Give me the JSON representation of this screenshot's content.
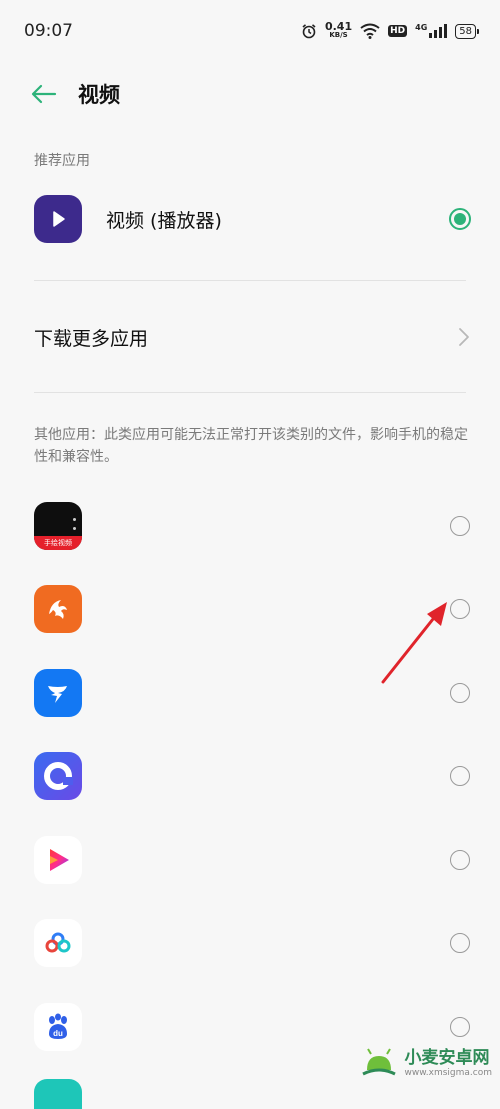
{
  "status_bar": {
    "time": "09:07",
    "speed_value": "0.41",
    "speed_unit": "KB/S",
    "hd": "HD",
    "network": "4G",
    "battery": "58"
  },
  "header": {
    "title": "视频",
    "back_icon": "arrow-left-icon"
  },
  "recommended": {
    "section_label": "推荐应用",
    "app": {
      "name": "视频 (播放器)",
      "selected": true
    }
  },
  "download_more": {
    "label": "下载更多应用"
  },
  "other_apps": {
    "section_label": "其他应用：此类应用可能无法正常打开该类别的文件，影响手机的稳定性和兼容性。",
    "apps": [
      {
        "icon": "handpaint-video-app-icon",
        "icon_text": "手绘视频",
        "selected": false
      },
      {
        "icon": "uc-browser-app-icon",
        "selected": false
      },
      {
        "icon": "dingtalk-app-icon",
        "selected": false
      },
      {
        "icon": "circle-c-app-icon",
        "selected": false
      },
      {
        "icon": "play-triangle-app-icon",
        "selected": false
      },
      {
        "icon": "cloud-rings-app-icon",
        "selected": false
      },
      {
        "icon": "baidu-app-icon",
        "icon_text": "du",
        "selected": false
      }
    ]
  },
  "watermark": {
    "title": "小麦安卓网",
    "url": "www.xmsigma.com"
  },
  "colors": {
    "accent": "#2db37a",
    "annotation_arrow": "#e0242b"
  }
}
